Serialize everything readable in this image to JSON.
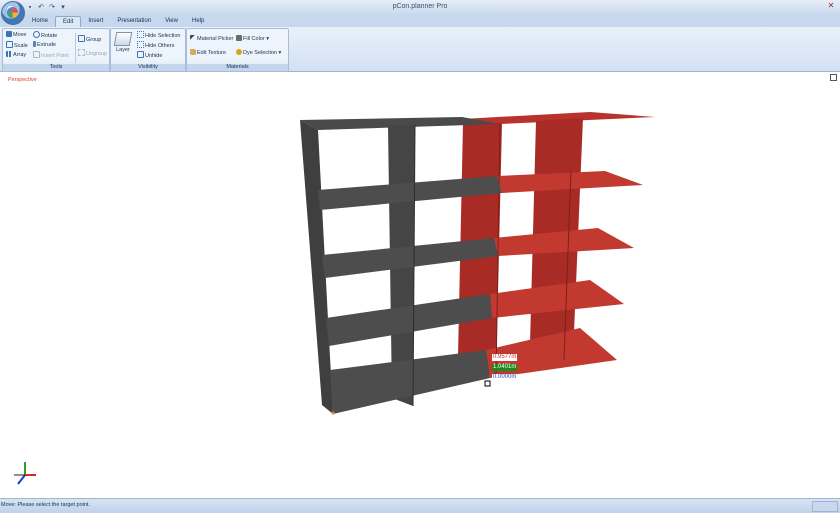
{
  "window": {
    "title": "pCon.planner Pro",
    "close_glyph": "✕"
  },
  "quick_access": [
    {
      "icon": "save-icon",
      "glyph": "▪"
    },
    {
      "icon": "undo-icon",
      "glyph": "↶"
    },
    {
      "icon": "redo-icon",
      "glyph": "↷"
    },
    {
      "icon": "customize-icon",
      "glyph": "▾"
    }
  ],
  "tabs": [
    {
      "label": "Home",
      "active": false
    },
    {
      "label": "Edit",
      "active": true
    },
    {
      "label": "Insert",
      "active": false
    },
    {
      "label": "Presentation",
      "active": false
    },
    {
      "label": "View",
      "active": false
    },
    {
      "label": "Help",
      "active": false
    }
  ],
  "ribbon": {
    "tools": {
      "label": "Tools",
      "move": "Move",
      "rotate": "Rotate",
      "scale": "Scale",
      "extrude": "Extrude",
      "array": "Array",
      "insert_point": "Insert Point",
      "group": "Group",
      "ungroup": "Ungroup"
    },
    "visibility": {
      "label": "Visibility",
      "layer": "Layer",
      "hide_selection": "Hide Selection",
      "hide_others": "Hide Others",
      "unhide": "Unhide"
    },
    "materials": {
      "label": "Materials",
      "material_picker": "Material Picker",
      "fill_color": "Fill Color",
      "edit_texture": "Edit Texture",
      "dye_selection": "Dye Selection"
    }
  },
  "view": {
    "label": "Perspective"
  },
  "measure": {
    "value1": "0.9577m",
    "value2": "1.0401m",
    "value3": "0.0000m"
  },
  "colors": {
    "shelf_dark": "#4a4a4a",
    "shelf_red": "#b8332d",
    "accent": "#3a6ea8"
  },
  "status": {
    "text": "Move: Please select the target point."
  }
}
